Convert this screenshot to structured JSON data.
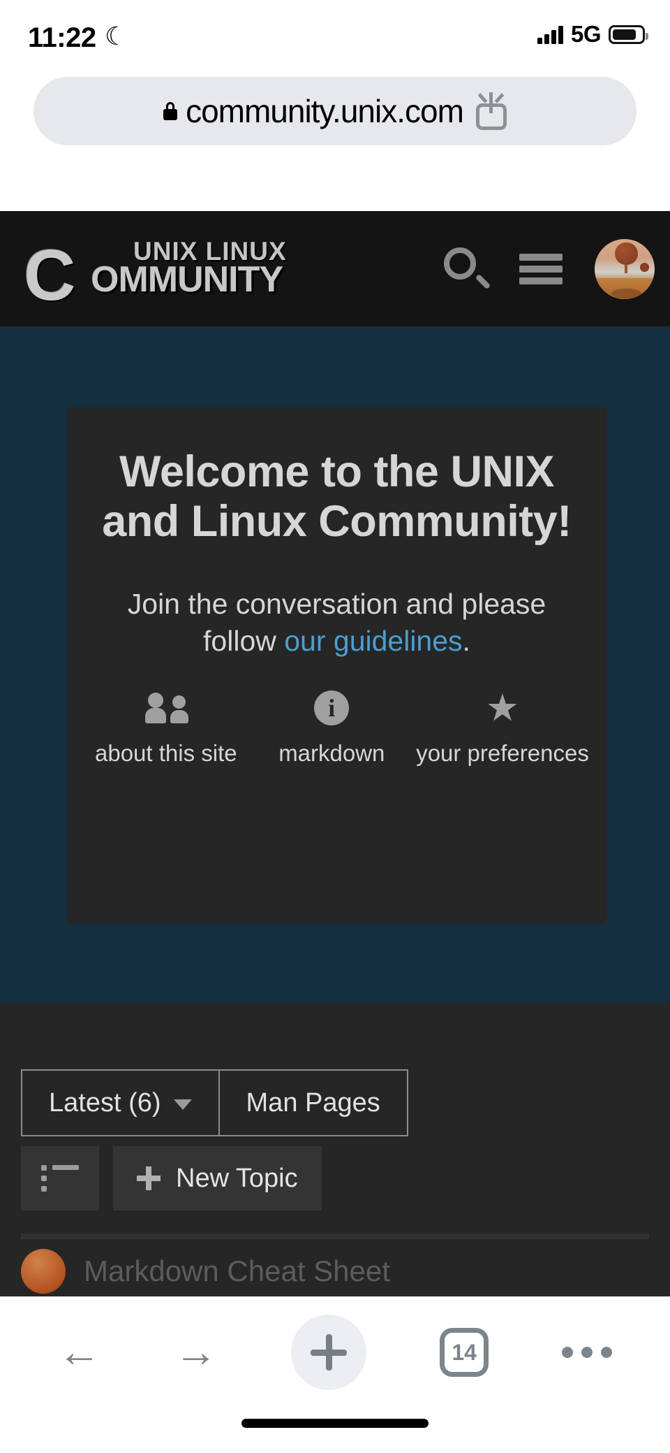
{
  "status_bar": {
    "time": "11:22",
    "moon_icon": "crescent-moon",
    "network": "5G",
    "signal_bars": 4,
    "battery_icon": "battery-full"
  },
  "browser": {
    "url": "community.unix.com",
    "lock_icon": "lock-secure",
    "share_icon": "share",
    "bottom_bar": {
      "back_label": "←",
      "forward_label": "→",
      "new_tab_label": "+",
      "tab_count": "14",
      "more_label": "•••"
    }
  },
  "site_header": {
    "logo_c": "C",
    "logo_line1": "UNIX LINUX",
    "logo_line2": "OMMUNITY",
    "search_icon": "search",
    "menu_icon": "hamburger-menu",
    "avatar_icon": "user-avatar"
  },
  "hero": {
    "title": "Welcome to the UNIX and Linux Community!",
    "subtitle_before": "Join the conversation and please follow ",
    "subtitle_link": "our guidelines",
    "subtitle_after": ".",
    "quick_links": [
      {
        "label": "about this site",
        "icon": "users-icon"
      },
      {
        "label": "markdown",
        "icon": "info-circle-icon"
      },
      {
        "label": "your preferences",
        "icon": "star-icon"
      }
    ]
  },
  "list_area": {
    "tabs": [
      {
        "label": "Latest (6)",
        "has_caret": true
      },
      {
        "label": "Man Pages",
        "has_caret": false
      }
    ],
    "list_view_icon": "list-icon",
    "new_topic_label": "New Topic",
    "topics": [
      {
        "title": "Markdown Cheat Sheet"
      }
    ]
  },
  "colors": {
    "header_bg": "#141414",
    "hero_bg": "#143040",
    "card_bg": "#262626",
    "link_blue": "#4a9ed0",
    "text_light": "#d6d6d6"
  }
}
